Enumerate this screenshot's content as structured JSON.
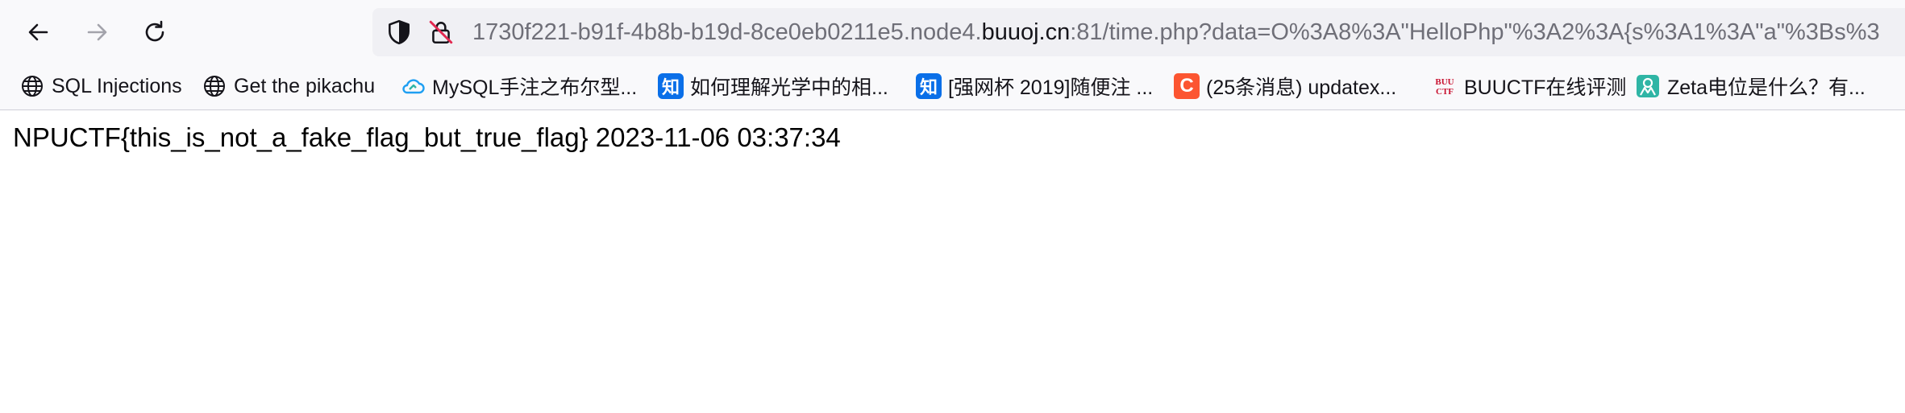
{
  "navigation": {
    "back_icon": "arrow-left-icon",
    "forward_icon": "arrow-right-icon",
    "reload_icon": "reload-icon"
  },
  "url_bar": {
    "prefix": "1730f221-b91f-4b8b-b19d-8ce0eb0211e5.node4.",
    "domain": "buuoj.cn",
    "suffix": ":81/time.php?data=O%3A8%3A\"HelloPhp\"%3A2%3A{s%3A1%3A\"a\"%3Bs%3",
    "shield_icon": "tracking-shield-icon",
    "lock_icon": "insecure-lock-icon"
  },
  "bookmarks": [
    {
      "label": "SQL Injections",
      "icon": "globe-icon"
    },
    {
      "label": "Get the pikachu",
      "icon": "globe-icon"
    },
    {
      "label": "MySQL手注之布尔型...",
      "icon": "cloud-icon"
    },
    {
      "label": "如何理解光学中的相...",
      "icon": "zhihu-icon",
      "icon_text": "知"
    },
    {
      "label": "[强网杯 2019]随便注 ...",
      "icon": "zhihu-icon",
      "icon_text": "知"
    },
    {
      "label": "(25条消息) updatex...",
      "icon": "csdn-icon",
      "icon_text": "C"
    },
    {
      "label": "BUUCTF在线评测",
      "icon": "buuctf-icon",
      "icon_text": "BUU CTF"
    },
    {
      "label": "Zeta电位是什么？有...",
      "icon": "person-icon"
    }
  ],
  "colors": {
    "chrome_bg": "#f9f9fb",
    "url_bar_bg": "#f0f0f4",
    "zhihu_blue": "#0a6fe8",
    "csdn_orange": "#fc5531",
    "buu_red": "#c8102e",
    "teal": "#2fb5a5"
  },
  "page": {
    "text": "NPUCTF{this_is_not_a_fake_flag_but_true_flag} 2023-11-06 03:37:34"
  }
}
